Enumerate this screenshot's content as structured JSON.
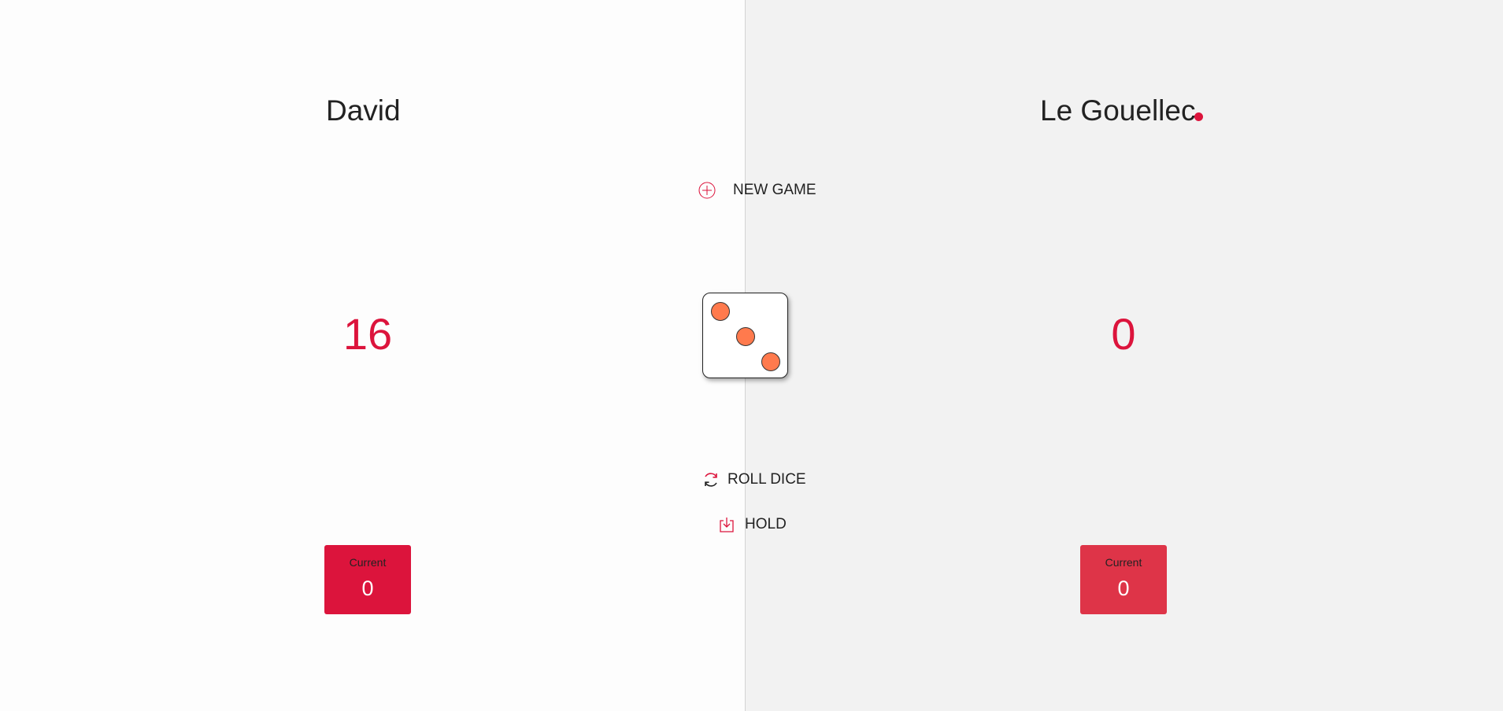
{
  "players": [
    {
      "name": "David",
      "score": "16",
      "current_label": "Current",
      "current_value": "0",
      "active": false
    },
    {
      "name": "Le Gouellec",
      "score": "0",
      "current_label": "Current",
      "current_value": "0",
      "active": true
    }
  ],
  "controls": {
    "new_game_label": "NEW GAME",
    "new_game_icon": "plus-circle-icon",
    "roll_dice_label": "ROLL DICE",
    "roll_dice_icon": "refresh-icon",
    "hold_label": "HOLD",
    "hold_icon": "download-icon"
  },
  "dice": {
    "value": 3,
    "pip_color": "#ff7a4d"
  },
  "colors": {
    "accent": "#dc143c",
    "accent_light": "#de3448",
    "left_bg": "#fdfdfd",
    "right_bg": "#f2f2f2"
  }
}
